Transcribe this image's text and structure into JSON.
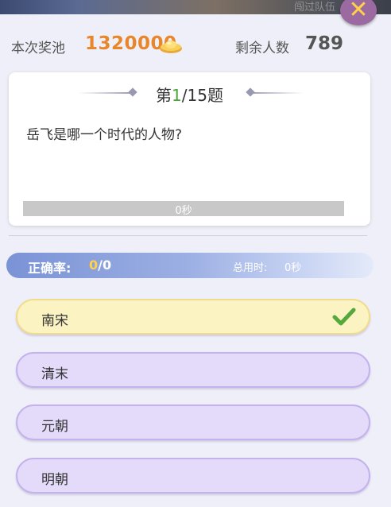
{
  "header": {
    "ghost_text": "闯过队伍"
  },
  "stats": {
    "pool_label": "本次奖池",
    "pool_value": "1320000",
    "remaining_label": "剩余人数",
    "remaining_value": "789"
  },
  "question": {
    "title_prefix": "第",
    "current": "1",
    "title_suffix": "/15题",
    "text": "岳飞是哪一个时代的人物?",
    "timer_text": "0秒",
    "timer_progress": 0
  },
  "summary": {
    "accuracy_label": "正确率:",
    "accuracy_correct": "0",
    "accuracy_total": "/0",
    "time_label": "总用时:",
    "time_value": "0秒"
  },
  "options": [
    {
      "label": "南宋",
      "state": "correct"
    },
    {
      "label": "清末",
      "state": "normal"
    },
    {
      "label": "元朝",
      "state": "normal"
    },
    {
      "label": "明朝",
      "state": "normal"
    }
  ],
  "colors": {
    "pool_accent": "#e8862c",
    "correct_green": "#49a537",
    "option_bg": "#e4daf9",
    "correct_bg": "#fbf3c2"
  },
  "icons": {
    "close": "close-icon",
    "ingot": "gold-ingot-icon",
    "check": "check-icon"
  }
}
